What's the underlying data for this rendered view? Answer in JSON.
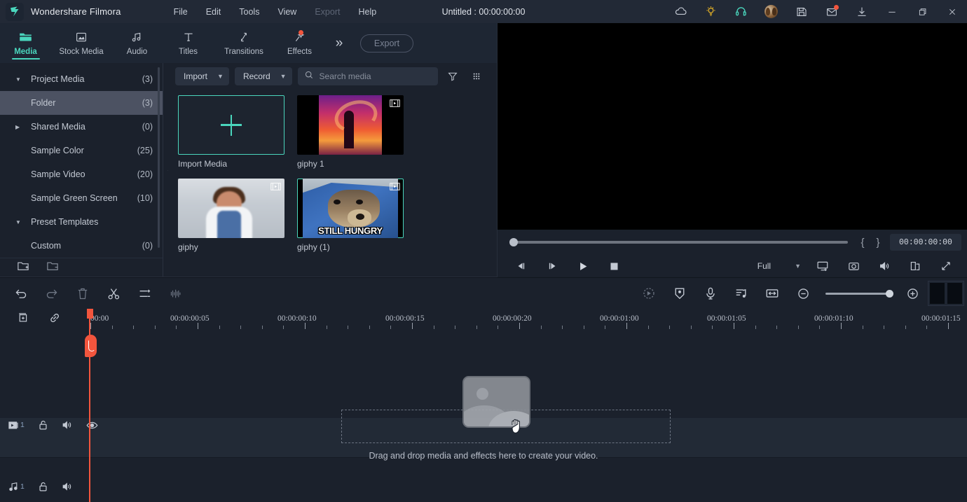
{
  "app": {
    "brand": "Wondershare Filmora",
    "document_title": "Untitled : 00:00:00:00",
    "accent_color": "#4ad6bd",
    "playhead_color": "#f2553d"
  },
  "menubar": [
    {
      "label": "File",
      "disabled": false
    },
    {
      "label": "Edit",
      "disabled": false
    },
    {
      "label": "Tools",
      "disabled": false
    },
    {
      "label": "View",
      "disabled": false
    },
    {
      "label": "Export",
      "disabled": true
    },
    {
      "label": "Help",
      "disabled": false
    }
  ],
  "title_icons": [
    {
      "name": "cloud-icon"
    },
    {
      "name": "lightbulb-icon"
    },
    {
      "name": "headset-icon"
    },
    {
      "name": "user-avatar"
    },
    {
      "name": "save-icon"
    },
    {
      "name": "mail-icon",
      "badge": true
    },
    {
      "name": "download-icon"
    },
    {
      "name": "minimize-icon"
    },
    {
      "name": "maximize-icon"
    },
    {
      "name": "close-icon"
    }
  ],
  "topnav": {
    "tabs": [
      {
        "label": "Media",
        "icon": "folder-icon",
        "active": true,
        "badge": false
      },
      {
        "label": "Stock Media",
        "icon": "stock-media-icon",
        "active": false,
        "badge": false
      },
      {
        "label": "Audio",
        "icon": "music-note-icon",
        "active": false,
        "badge": false
      },
      {
        "label": "Titles",
        "icon": "text-t-icon",
        "active": false,
        "badge": false
      },
      {
        "label": "Transitions",
        "icon": "transitions-icon",
        "active": false,
        "badge": false
      },
      {
        "label": "Effects",
        "icon": "effects-wand-icon",
        "active": false,
        "badge": true
      }
    ],
    "more_label": "»",
    "export_label": "Export"
  },
  "sidebar": {
    "items": [
      {
        "label": "Project Media",
        "count": "(3)",
        "arrow": "▼",
        "indent": 1,
        "selected": false
      },
      {
        "label": "Folder",
        "count": "(3)",
        "arrow": "",
        "indent": 2,
        "selected": true
      },
      {
        "label": "Shared Media",
        "count": "(0)",
        "arrow": "▶",
        "indent": 1,
        "selected": false
      },
      {
        "label": "Sample Color",
        "count": "(25)",
        "arrow": "",
        "indent": 2,
        "selected": false
      },
      {
        "label": "Sample Video",
        "count": "(20)",
        "arrow": "",
        "indent": 2,
        "selected": false
      },
      {
        "label": "Sample Green Screen",
        "count": "(10)",
        "arrow": "",
        "indent": 2,
        "selected": false
      },
      {
        "label": "Preset Templates",
        "count": "",
        "arrow": "▼",
        "indent": 1,
        "selected": false
      },
      {
        "label": "Custom",
        "count": "(0)",
        "arrow": "",
        "indent": 2,
        "selected": false
      }
    ],
    "footer_icons": [
      {
        "name": "new-folder-icon"
      },
      {
        "name": "remove-folder-icon"
      }
    ],
    "collapse_arrow": "◀"
  },
  "media_panel": {
    "import_label": "Import",
    "record_label": "Record",
    "search_placeholder": "Search media",
    "filter_icon": "filter-icon",
    "grid_view_icon": "grid-view-icon",
    "items": [
      {
        "caption": "Import Media",
        "kind": "import",
        "selected": true
      },
      {
        "caption": "giphy 1",
        "kind": "video",
        "selected": false
      },
      {
        "caption": "giphy",
        "kind": "video",
        "selected": false
      },
      {
        "caption": "giphy (1)",
        "kind": "video",
        "selected": true,
        "overlay_text": "STILL HUNGRY"
      }
    ]
  },
  "preview": {
    "timecode": "00:00:00:00",
    "mark_in": "{",
    "mark_out": "}",
    "quality_label": "Full",
    "controls": [
      {
        "name": "previous-frame-button"
      },
      {
        "name": "next-frame-button"
      },
      {
        "name": "play-button"
      },
      {
        "name": "stop-button"
      }
    ],
    "right_controls": [
      {
        "name": "render-preview-icon"
      },
      {
        "name": "snapshot-icon"
      },
      {
        "name": "volume-icon"
      },
      {
        "name": "pop-out-icon"
      },
      {
        "name": "fullscreen-icon"
      }
    ]
  },
  "timeline_toolbar": {
    "left_icons": [
      {
        "name": "undo-icon"
      },
      {
        "name": "redo-icon"
      },
      {
        "name": "delete-icon"
      },
      {
        "name": "split-icon"
      },
      {
        "name": "adjust-icon"
      },
      {
        "name": "audio-waveform-icon"
      }
    ],
    "right_icons": [
      {
        "name": "render-preview-icon"
      },
      {
        "name": "marker-icon"
      },
      {
        "name": "voiceover-icon"
      },
      {
        "name": "audio-mixer-icon"
      },
      {
        "name": "fit-timeline-icon"
      },
      {
        "name": "zoom-out-icon"
      },
      {
        "name": "zoom-in-icon"
      }
    ]
  },
  "timeline": {
    "head_icons": [
      {
        "name": "add-track-icon"
      },
      {
        "name": "link-icon"
      }
    ],
    "ruler_labels": [
      "00:00",
      "00:00:00:05",
      "00:00:00:10",
      "00:00:00:15",
      "00:00:00:20",
      "00:00:01:00",
      "00:00:01:05",
      "00:00:01:10",
      "00:00:01:15"
    ],
    "tracks": [
      {
        "type": "video",
        "number": "1",
        "icons": [
          "video-track-icon",
          "unlock-icon",
          "speaker-icon",
          "eye-icon"
        ]
      },
      {
        "type": "audio",
        "number": "1",
        "icons": [
          "audio-track-icon",
          "unlock-icon",
          "speaker-icon"
        ]
      }
    ],
    "dropzone_text": "Drag and drop media and effects here to create your video."
  }
}
